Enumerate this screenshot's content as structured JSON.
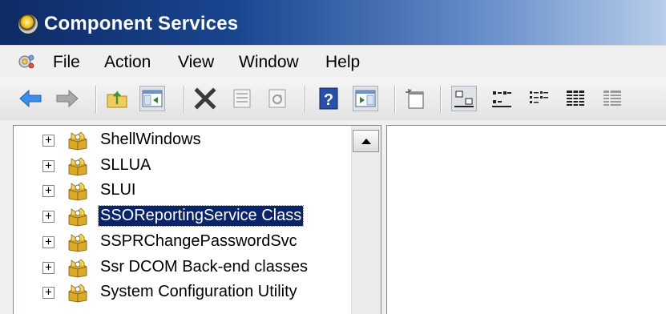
{
  "window": {
    "title": "Component Services",
    "icon": "component-services-icon"
  },
  "menu": {
    "items": [
      {
        "label": "File"
      },
      {
        "label": "Action"
      },
      {
        "label": "View"
      },
      {
        "label": "Window"
      },
      {
        "label": "Help"
      }
    ]
  },
  "toolbar": {
    "buttons": [
      "back-arrow-icon",
      "forward-arrow-icon",
      "up-folder-icon",
      "show-hide-console-tree-icon",
      "delete-icon",
      "properties-icon",
      "refresh-icon",
      "help-icon",
      "show-hide-action-pane-icon",
      "new-window-icon",
      "large-icons-view-icon",
      "small-icons-view-icon",
      "list-view-icon",
      "detail-view-icon",
      "status-view-icon"
    ],
    "pressed": [
      "show-hide-console-tree-icon",
      "show-hide-action-pane-icon"
    ]
  },
  "tree": {
    "items": [
      {
        "label": "ShellWindows",
        "expander": "+"
      },
      {
        "label": "SLLUA",
        "expander": "+"
      },
      {
        "label": "SLUI",
        "expander": "+"
      },
      {
        "label": "SSOReportingService Class",
        "expander": "+",
        "selected": true
      },
      {
        "label": "SSPRChangePasswordSvc",
        "expander": "+"
      },
      {
        "label": "Ssr DCOM Back-end classes",
        "expander": "+"
      },
      {
        "label": "System Configuration Utility",
        "expander": "+"
      }
    ],
    "node_icon": "component-package-icon"
  },
  "colors": {
    "title_bar": "#19458f",
    "selection": "#0a246a",
    "icon_yellow": "#e2b52a"
  }
}
